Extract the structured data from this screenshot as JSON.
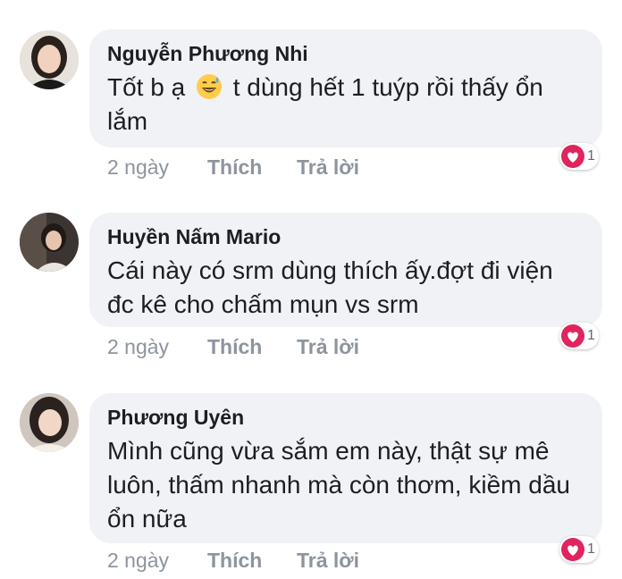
{
  "comments": [
    {
      "author": "Nguyễn Phương Nhi",
      "text_before_emoji": "Tốt b ạ",
      "emoji": "grinning-sweat-emoji",
      "text_after_emoji": "t dùng hết 1 tuýp rồi thấy ổn lắm",
      "time": "2 ngày",
      "like_label": "Thích",
      "reply_label": "Trả lời",
      "reaction": "heart",
      "reaction_count": "1"
    },
    {
      "author": "Huyền Nấm Mario",
      "text": "Cái này có srm dùng thích ấy.đợt đi viện đc kê cho chấm mụn vs srm",
      "time": "2 ngày",
      "like_label": "Thích",
      "reply_label": "Trả lời",
      "reaction": "heart",
      "reaction_count": "1"
    },
    {
      "author": "Phương Uyên",
      "text": "Mình cũng vừa sắm em này, thật sự mê luôn, thấm nhanh mà còn thơm, kiềm dầu ổn nữa",
      "time": "2 ngày",
      "like_label": "Thích",
      "reply_label": "Trả lời",
      "reaction": "heart",
      "reaction_count": "1"
    }
  ],
  "colors": {
    "bubble_bg": "#f0f2f5",
    "heart": "#e0245e",
    "meta_text": "#8d949e"
  }
}
